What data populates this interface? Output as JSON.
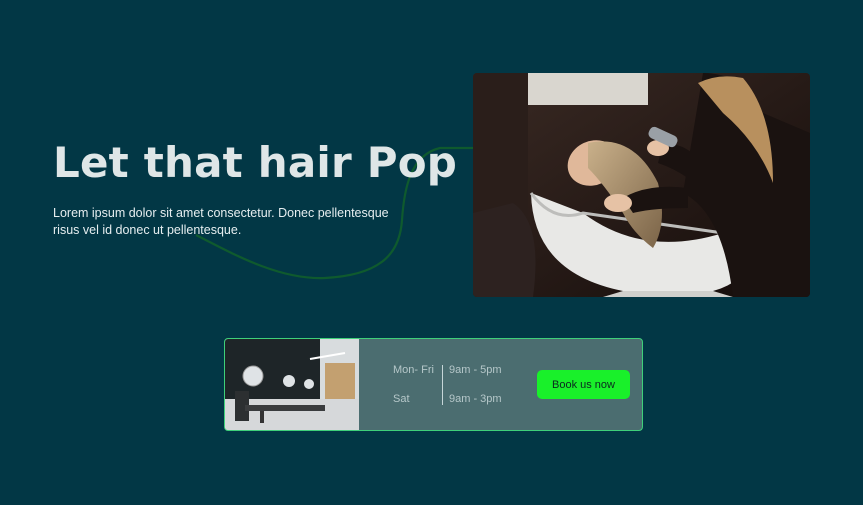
{
  "hero": {
    "title": "Let that hair Pop",
    "description": "Lorem ipsum dolor sit amet consectetur. Donec pellentesque risus vel id donec ut pellentesque."
  },
  "booking": {
    "hours": [
      {
        "day": "Mon- Fri",
        "time": "9am - 5pm"
      },
      {
        "day": "Sat",
        "time": "9am - 3pm"
      }
    ],
    "button_label": "Book us now"
  },
  "colors": {
    "background": "#023745",
    "card": "#4b6d70",
    "accent_green": "#19f02a",
    "curve": "#0f5a2e"
  },
  "images": {
    "hero": "hair-washing-photo",
    "card": "salon-interior-photo"
  }
}
